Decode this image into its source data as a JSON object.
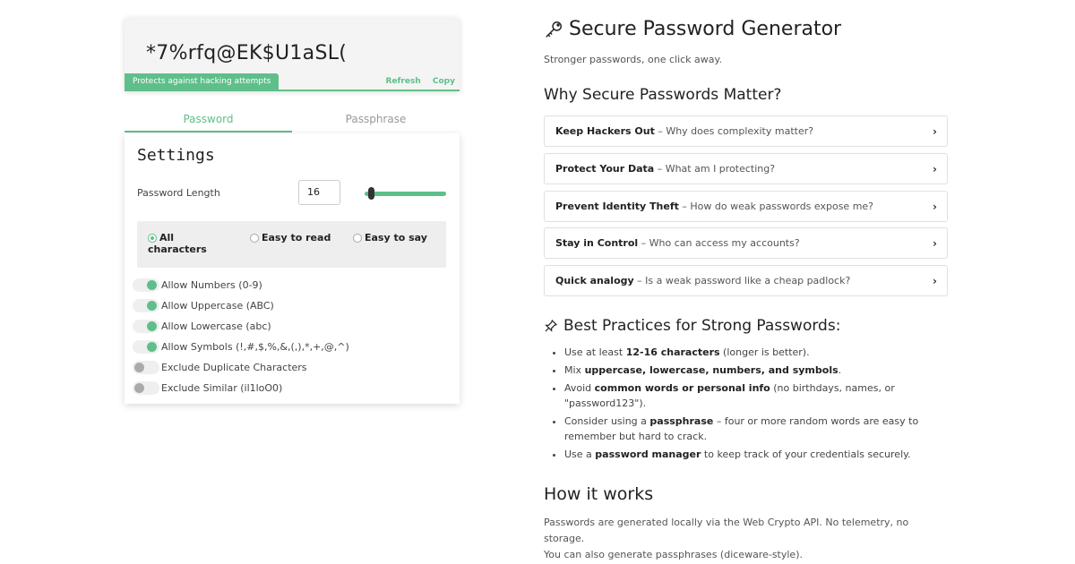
{
  "password": {
    "value": "*7%rfq@EK$U1aSL(",
    "badge": "Protects against hacking attempts",
    "refresh_label": "Refresh",
    "copy_label": "Copy"
  },
  "tabs": [
    {
      "label": "Password",
      "active": true
    },
    {
      "label": "Passphrase",
      "active": false
    }
  ],
  "settings": {
    "title": "Settings",
    "length_label": "Password Length",
    "length_value": "16",
    "char_modes": [
      {
        "label": "All",
        "label2": "characters",
        "selected": true
      },
      {
        "label": "Easy to read",
        "selected": false
      },
      {
        "label": "Easy to say",
        "selected": false
      }
    ],
    "toggles": [
      {
        "label": "Allow Numbers (0-9)",
        "on": true
      },
      {
        "label": "Allow Uppercase (ABC)",
        "on": true
      },
      {
        "label": "Allow Lowercase (abc)",
        "on": true
      },
      {
        "label": "Allow Symbols (!,#,$,%,&,(,),*,+,@,^)",
        "on": true
      },
      {
        "label": "Exclude Duplicate Characters",
        "on": false
      },
      {
        "label": "Exclude Similar (il1loO0)",
        "on": false
      }
    ]
  },
  "right": {
    "title": "Secure Password Generator",
    "subtitle": "Stronger passwords, one click away.",
    "why_heading": "Why Secure Passwords Matter?",
    "faqs": [
      {
        "bold": "Keep Hackers Out",
        "text": " – Why does complexity matter?"
      },
      {
        "bold": "Protect Your Data",
        "text": " – What am I protecting?"
      },
      {
        "bold": "Prevent Identity Theft",
        "text": " – How do weak passwords expose me?"
      },
      {
        "bold": "Stay in Control",
        "text": " – Who can access my accounts?"
      },
      {
        "bold": "Quick analogy",
        "text": " – Is a weak password like a cheap padlock?"
      }
    ],
    "chevron": "›",
    "bp_heading": "Best Practices for Strong Passwords:",
    "bp_items": [
      {
        "a": "Use at least ",
        "b": "12-16 characters",
        "c": " (longer is better)."
      },
      {
        "a": "Mix ",
        "b": "uppercase, lowercase, numbers, and symbols",
        "c": "."
      },
      {
        "a": "Avoid ",
        "b": "common words or personal info",
        "c": " (no birthdays, names, or \"password123\")."
      },
      {
        "a": "Consider using a ",
        "b": "passphrase",
        "c": " – four or more random words are easy to remember but hard to crack."
      },
      {
        "a": "Use a ",
        "b": "password manager",
        "c": " to keep track of your credentials securely."
      }
    ],
    "how_heading": "How it works",
    "how_text_1": "Passwords are generated locally via the Web Crypto API. No telemetry, no storage.",
    "how_text_2": "You can also generate passphrases (diceware-style)."
  },
  "colors": {
    "accent": "#5fbf8a"
  }
}
